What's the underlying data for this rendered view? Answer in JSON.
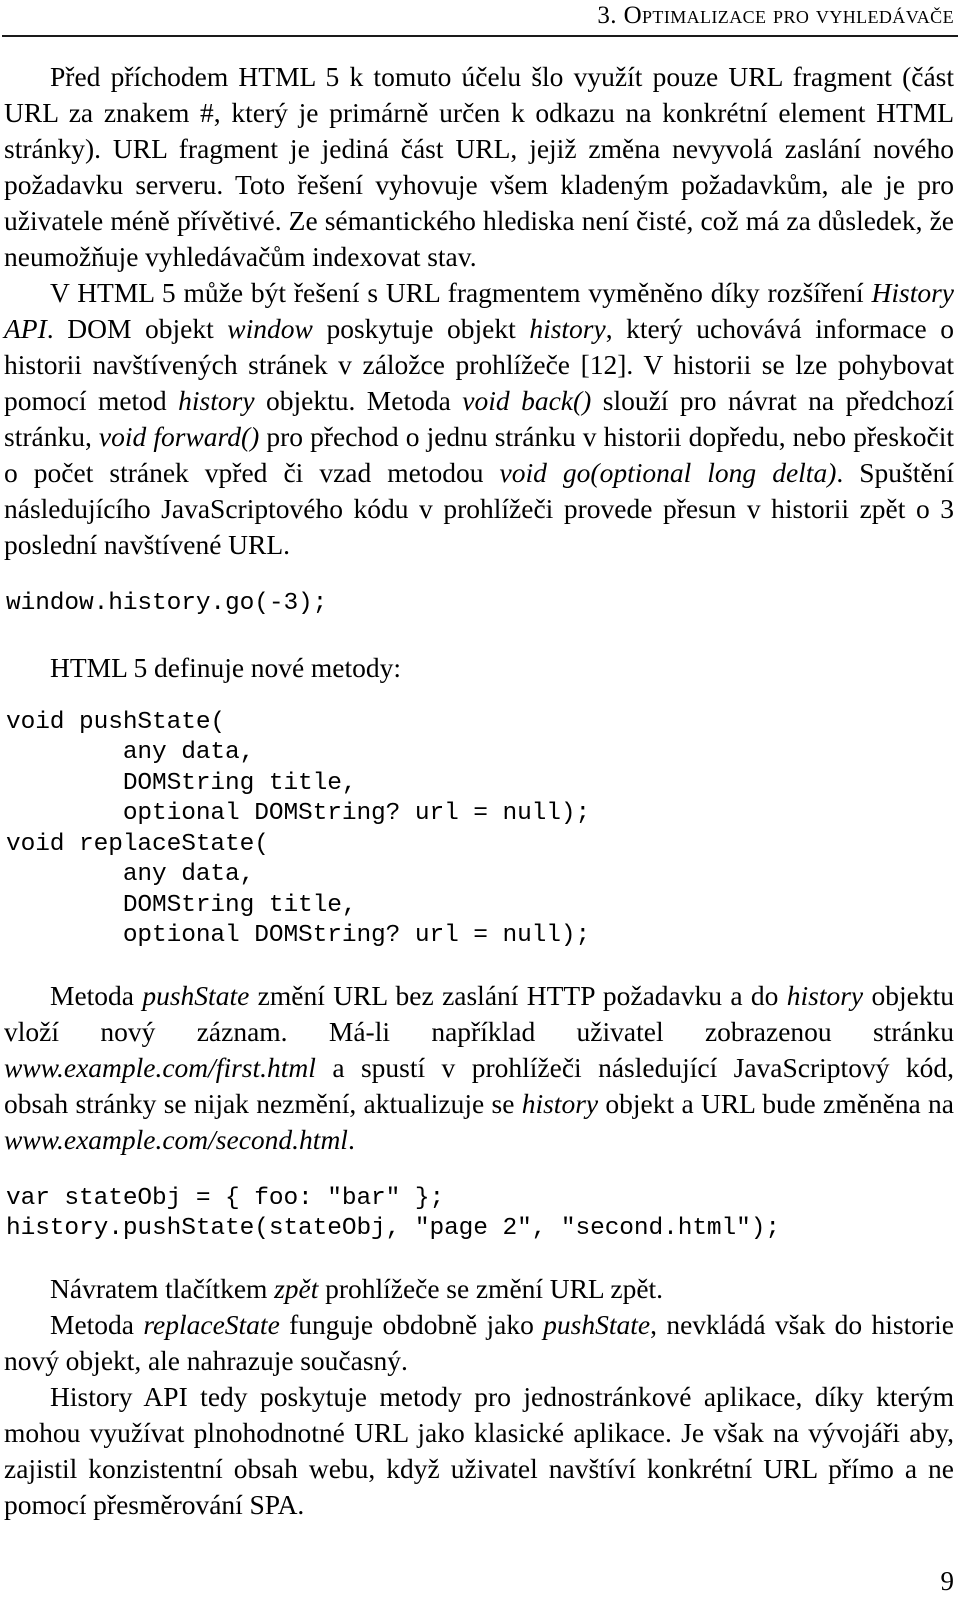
{
  "header": {
    "chapter_number": "3.",
    "chapter_title": "Optimalizace pro vyhledávače"
  },
  "paragraphs": {
    "p1_a": "Před příchodem HTML 5 k tomuto účelu šlo využít pouze URL fragment (část URL za znakem #, který je primárně určen k odkazu na konkrétní element HTML stránky). URL fragment je jediná část URL, jejiž změna nevyvolá zaslání nového požadavku serveru. Toto řešení vyhovuje všem kladeným požadavkům, ale je pro uživatele méně přívětivé. Ze sémantického hlediska není čisté, což má za důsledek, že neumožňuje vyhledávačům indexovat stav.",
    "p2_s1": "V HTML 5 může být řešení s URL fragmentem vyměněno díky rozšíření ",
    "p2_i1": "History API",
    "p2_s2": ". DOM objekt ",
    "p2_i2": "window",
    "p2_s3": " poskytuje objekt ",
    "p2_i3": "history",
    "p2_s4": ", který uchovává informace o historii navštívených stránek v záložce prohlížeče [12]. V historii se lze pohybovat pomocí metod ",
    "p2_i4": "history",
    "p2_s5": " objektu. Metoda ",
    "p2_i5": "void back()",
    "p2_s6": " slouží pro návrat na předchozí stránku, ",
    "p2_i6": "void forward()",
    "p2_s7": " pro přechod o jednu stránku v historii dopředu, nebo přeskočit o počet stránek vpřed či vzad metodou ",
    "p2_i7": "void go(optional long delta)",
    "p2_s8": ". Spuštění následujícího JavaScriptového kódu v prohlížeči provede přesun v historii zpět o 3 poslední navštívené URL.",
    "p3": "HTML 5 definuje nové metody:",
    "p4_s1": "Metoda ",
    "p4_i1": "pushState",
    "p4_s2": " změní URL bez zaslání HTTP požadavku a do ",
    "p4_i2": "history",
    "p4_s3": " objektu vloží nový záznam. Má-li například uživatel zobrazenou stránku ",
    "p4_i3": "www.example.com/first.html",
    "p4_s4": " a spustí v prohlížeči následující JavaScriptový kód, obsah stránky se nijak nezmění, aktualizuje se ",
    "p4_i4": "history",
    "p4_s5": " objekt a URL bude změněna na ",
    "p4_i5": "www.example.com/second.html",
    "p4_s6": ".",
    "p5_s1": "Návratem tlačítkem ",
    "p5_i1": "zpět",
    "p5_s2": " prohlížeče se změní URL zpět.",
    "p6_s1": "Metoda ",
    "p6_i1": "replaceState",
    "p6_s2": " funguje obdobně jako ",
    "p6_i2": "pushState",
    "p6_s3": ", nevkládá však do historie nový objekt, ale nahrazuje současný.",
    "p7": "History API tedy poskytuje metody pro jednostránkové aplikace, díky kterým mohou využívat plnohodnotné URL jako klasické aplikace. Je však na vývojáři aby, zajistil konzistentní obsah webu, když uživatel navštíví konkrétní URL přímo a ne pomocí přesměrování SPA."
  },
  "code_blocks": {
    "block1": "window.history.go(-3);",
    "block2": "void pushState(\n        any data,\n        DOMString title,\n        optional DOMString? url = null);\nvoid replaceState(\n        any data,\n        DOMString title,\n        optional DOMString? url = null);",
    "block3": "var stateObj = { foo: \"bar\" };\nhistory.pushState(stateObj, \"page 2\", \"second.html\");"
  },
  "folio": "9"
}
